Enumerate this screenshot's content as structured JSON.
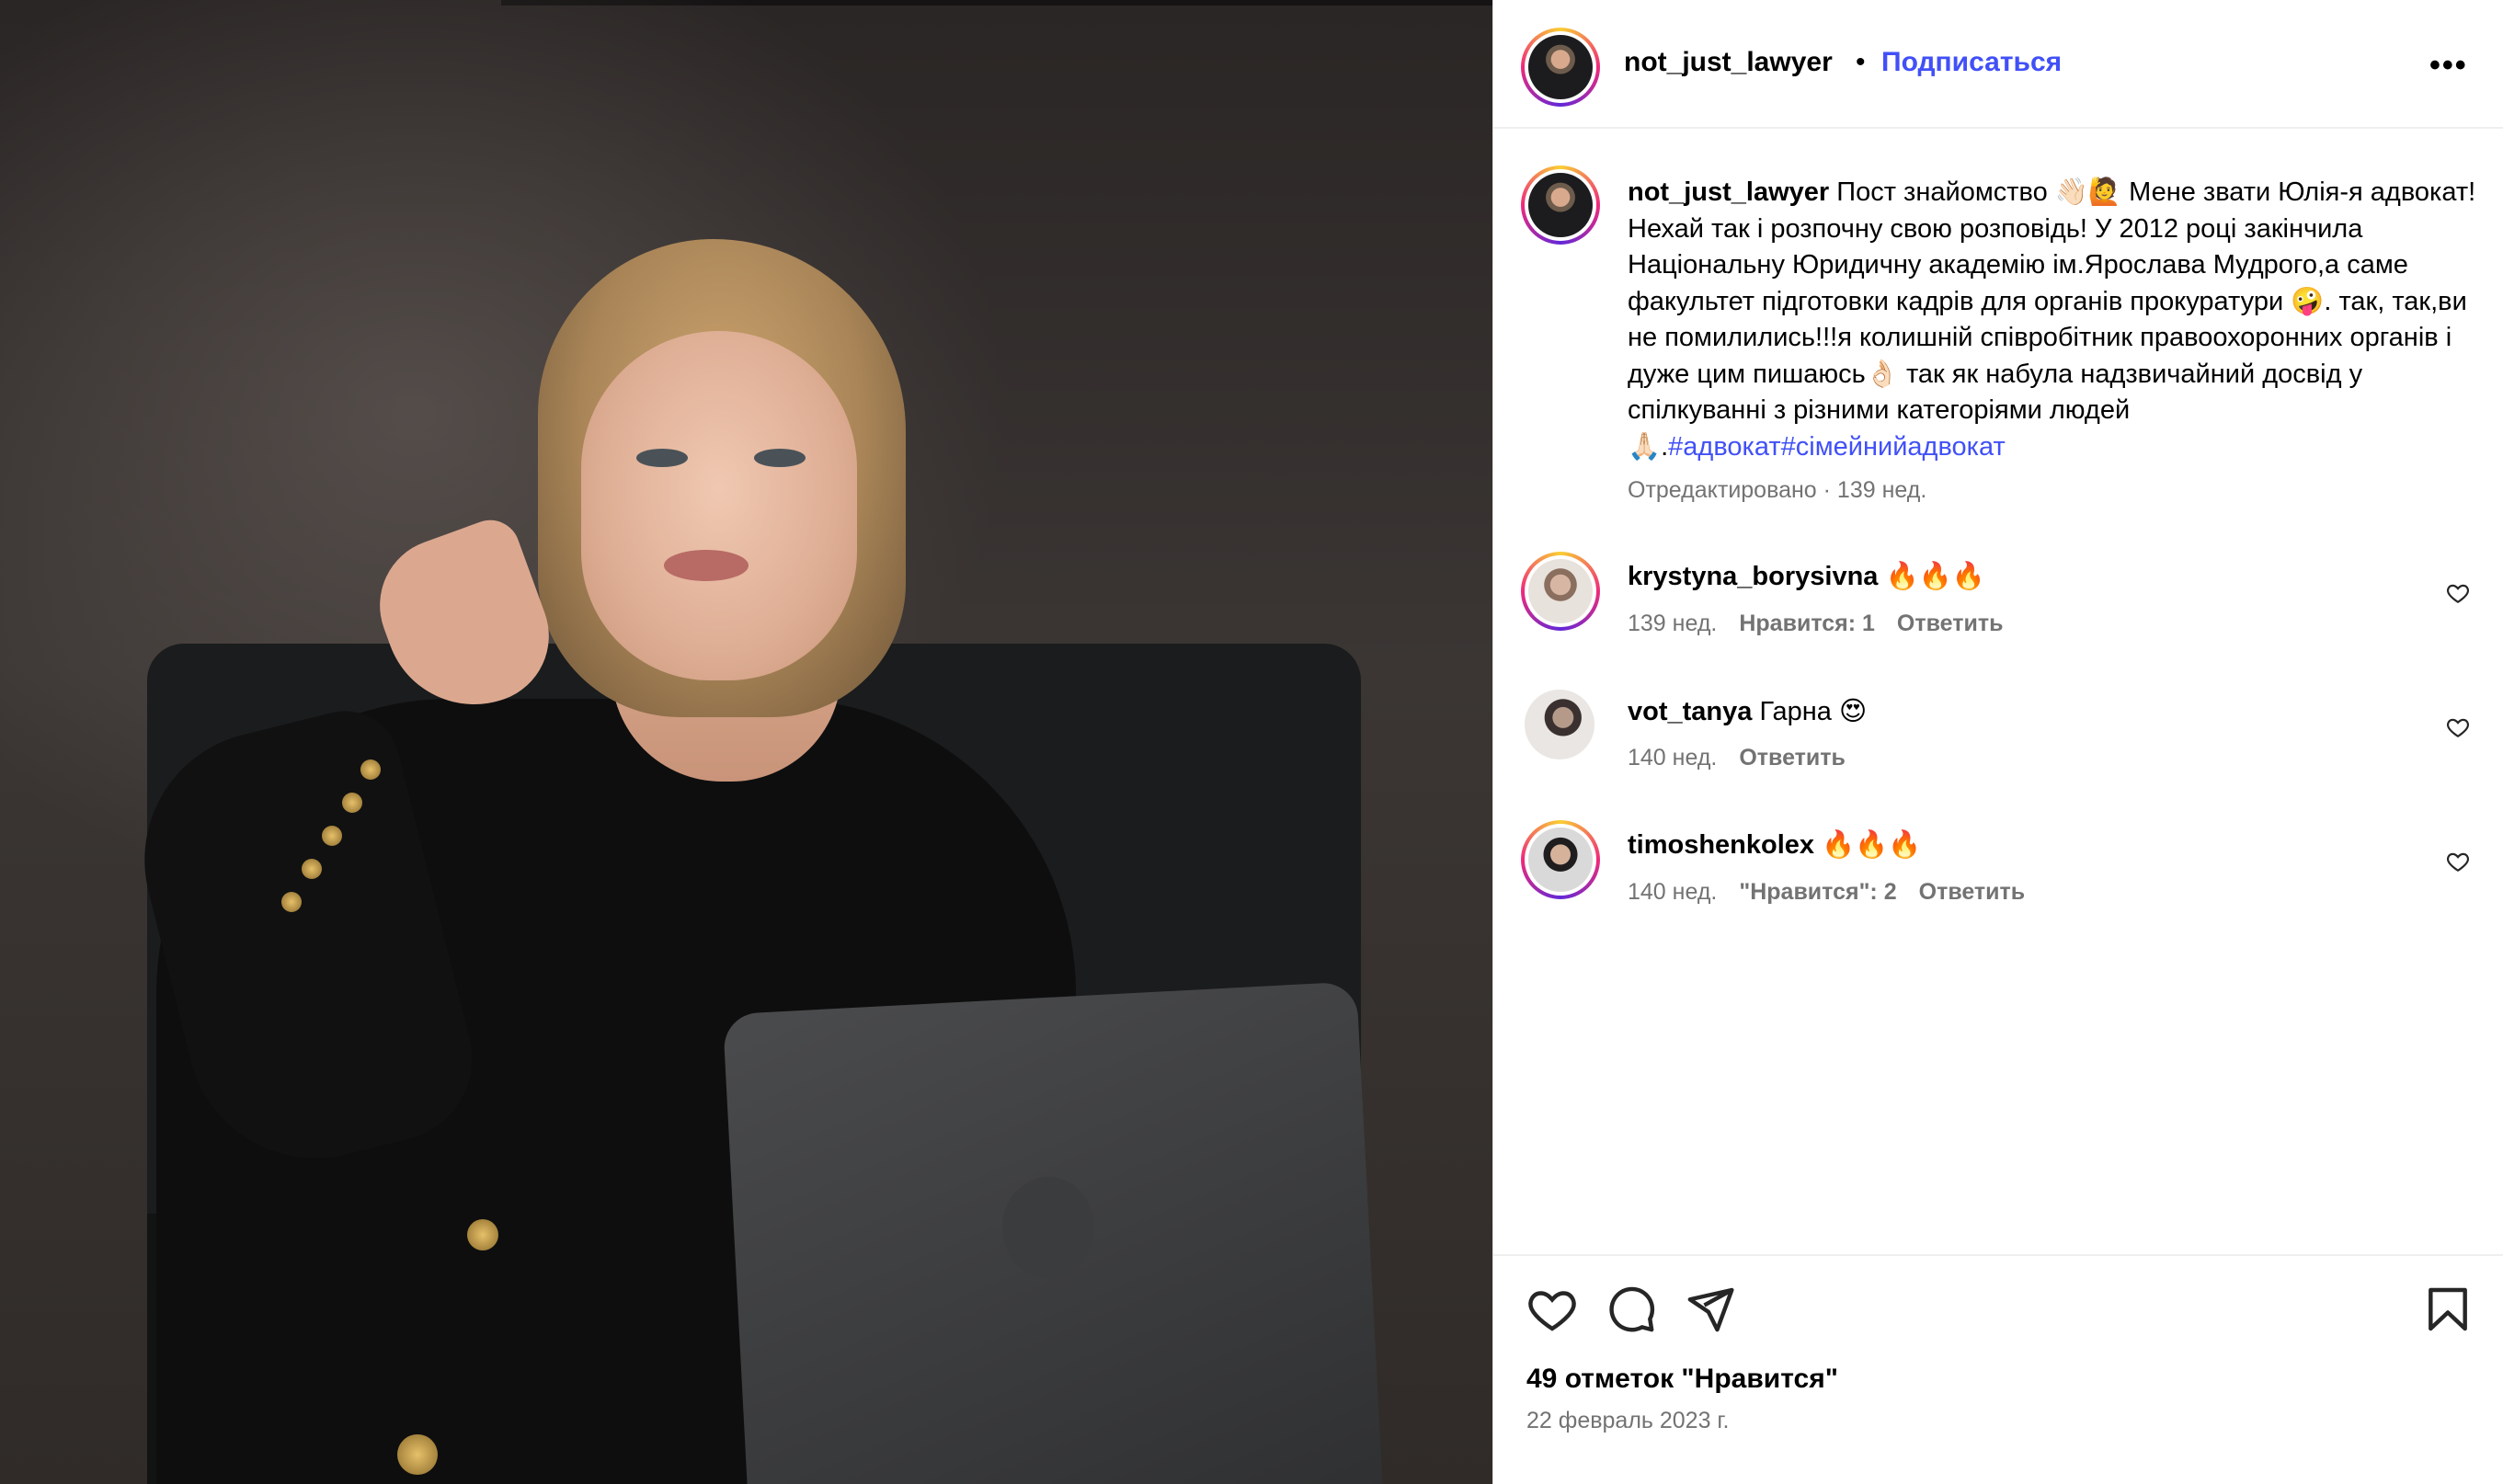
{
  "post": {
    "author": "not_just_lawyer",
    "follow_label": "Подписаться",
    "separator": "•",
    "more_label": "•••",
    "caption_author": "not_just_lawyer",
    "caption_text": "Пост знайомство 👋🏻🙋 Мене звати Юлія-я адвокат! Нехай так і розпочну свою розповідь! У 2012 році закінчила Національну Юридичну академію ім.Ярослава Мудрого,а саме факультет підготовки кадрів для органів прокуратури 🤪. так, так,ви не помилились!!!я колишній співробітник правоохоронних органів і дуже цим пишаюсь👌🏻 так як набула надзвичайний досвід у спілкуванні з різними категоріями людей 🙏🏻.",
    "hashtags": "#адвокат#сімейнийадвокат",
    "meta": "Отредактировано · 139 нед."
  },
  "comments": [
    {
      "user": "krystyna_borysivna",
      "text": "🔥🔥🔥",
      "age": "139 нед.",
      "likes": "Нравится: 1",
      "reply": "Ответить"
    },
    {
      "user": "vot_tanya",
      "text": "Гарна 😍",
      "age": "140 нед.",
      "likes": "",
      "reply": "Ответить"
    },
    {
      "user": "timoshenkolex",
      "text": "🔥🔥🔥",
      "age": "140 нед.",
      "likes": "\"Нравится\": 2",
      "reply": "Ответить"
    }
  ],
  "footer": {
    "likes": "49 отметок \"Нравится\"",
    "date": "22 февраль 2023 г."
  },
  "colors": {
    "link": "#4150f7",
    "muted": "#737373"
  },
  "icons": [
    "heart-icon",
    "comment-icon",
    "share-icon",
    "bookmark-icon",
    "more-icon"
  ]
}
